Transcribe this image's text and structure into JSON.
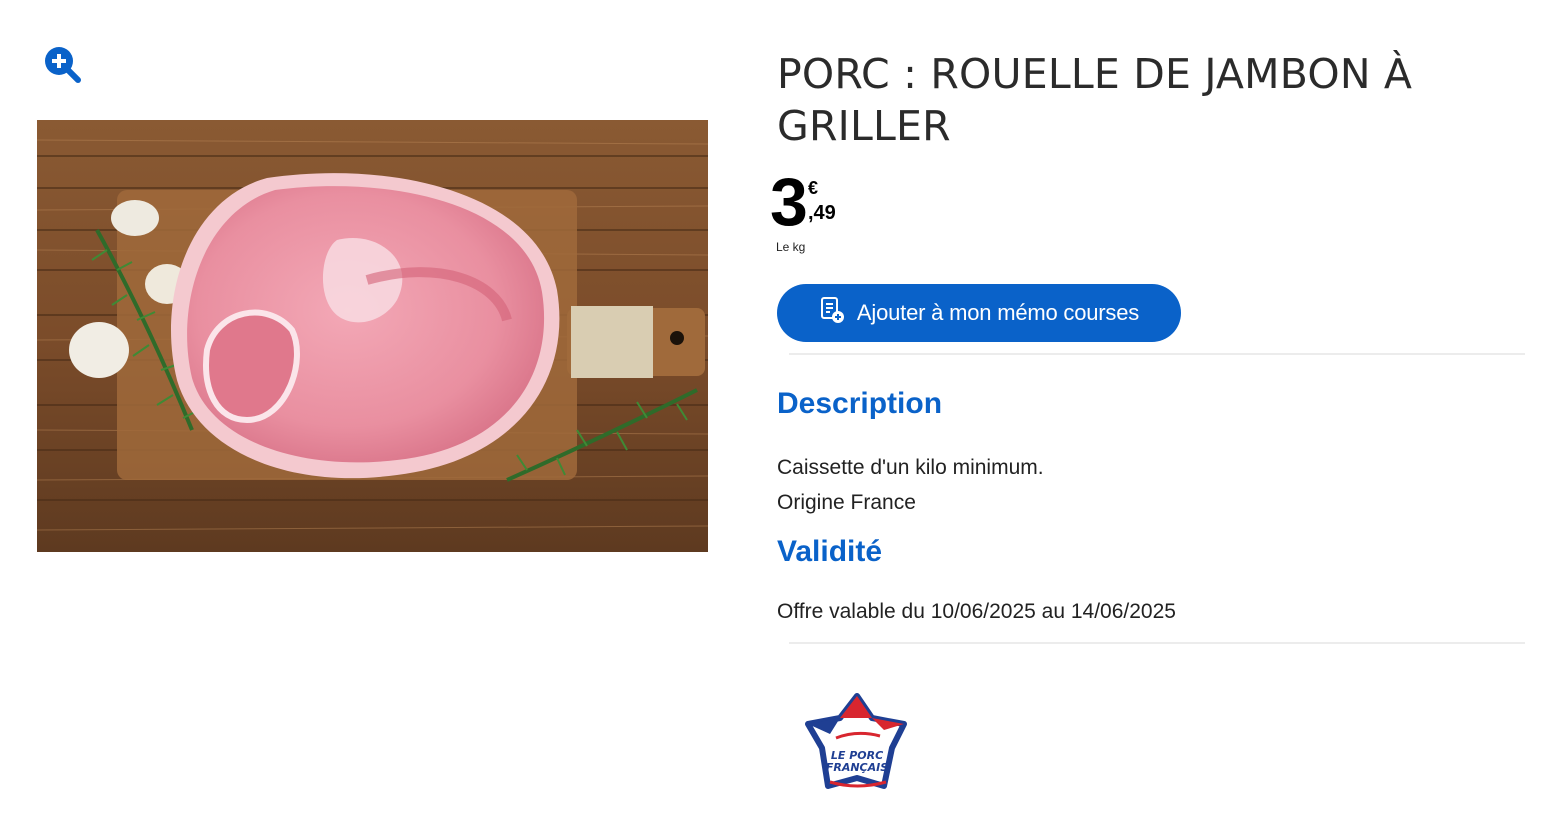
{
  "zoom": {
    "icon": "zoom-in-icon",
    "color": "#0a62c9"
  },
  "product": {
    "image": {
      "subject": "rouelle-de-jambon-photo"
    },
    "title": "PORC : ROUELLE DE JAMBON À GRILLER",
    "price": {
      "units": "3",
      "currency": "€",
      "cents": ",49",
      "unit_label": "Le kg"
    }
  },
  "memo_button": {
    "label": "Ajouter à mon mémo courses",
    "icon": "memo-add-icon",
    "color": "#0a62c9"
  },
  "description": {
    "heading": "Description",
    "lines": [
      "Caissette d'un kilo minimum.",
      "Origine France"
    ]
  },
  "validity": {
    "heading": "Validité",
    "text": "Offre valable du 10/06/2025 au 14/06/2025"
  },
  "origin_logo": {
    "line1": "LE PORC",
    "line2": "FRANÇAIS",
    "colors": {
      "blue": "#1f3f93",
      "red": "#d8262f"
    }
  }
}
